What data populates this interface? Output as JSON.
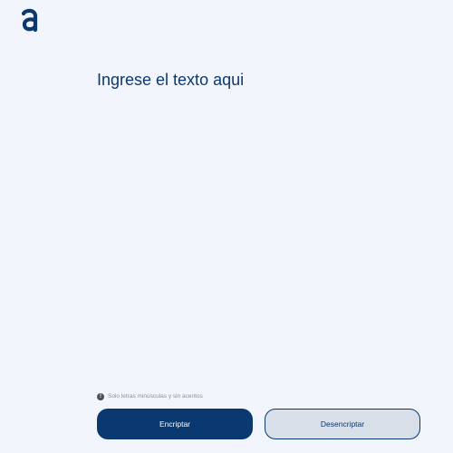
{
  "brand": {
    "logo_icon": "alura-a-logo",
    "color": "#0a3871"
  },
  "input": {
    "placeholder": "Ingrese el texto aqui",
    "value": ""
  },
  "hint": {
    "icon": "exclamation-circle-icon",
    "text": "Solo letras minúsculas y sin acentos"
  },
  "buttons": {
    "encrypt_label": "Encriptar",
    "decrypt_label": "Desencriptar"
  },
  "colors": {
    "background": "#f3f5fc",
    "primary": "#0a3871",
    "secondary_button_bg": "#d8dfe8",
    "hint_text": "#8a8f99"
  }
}
